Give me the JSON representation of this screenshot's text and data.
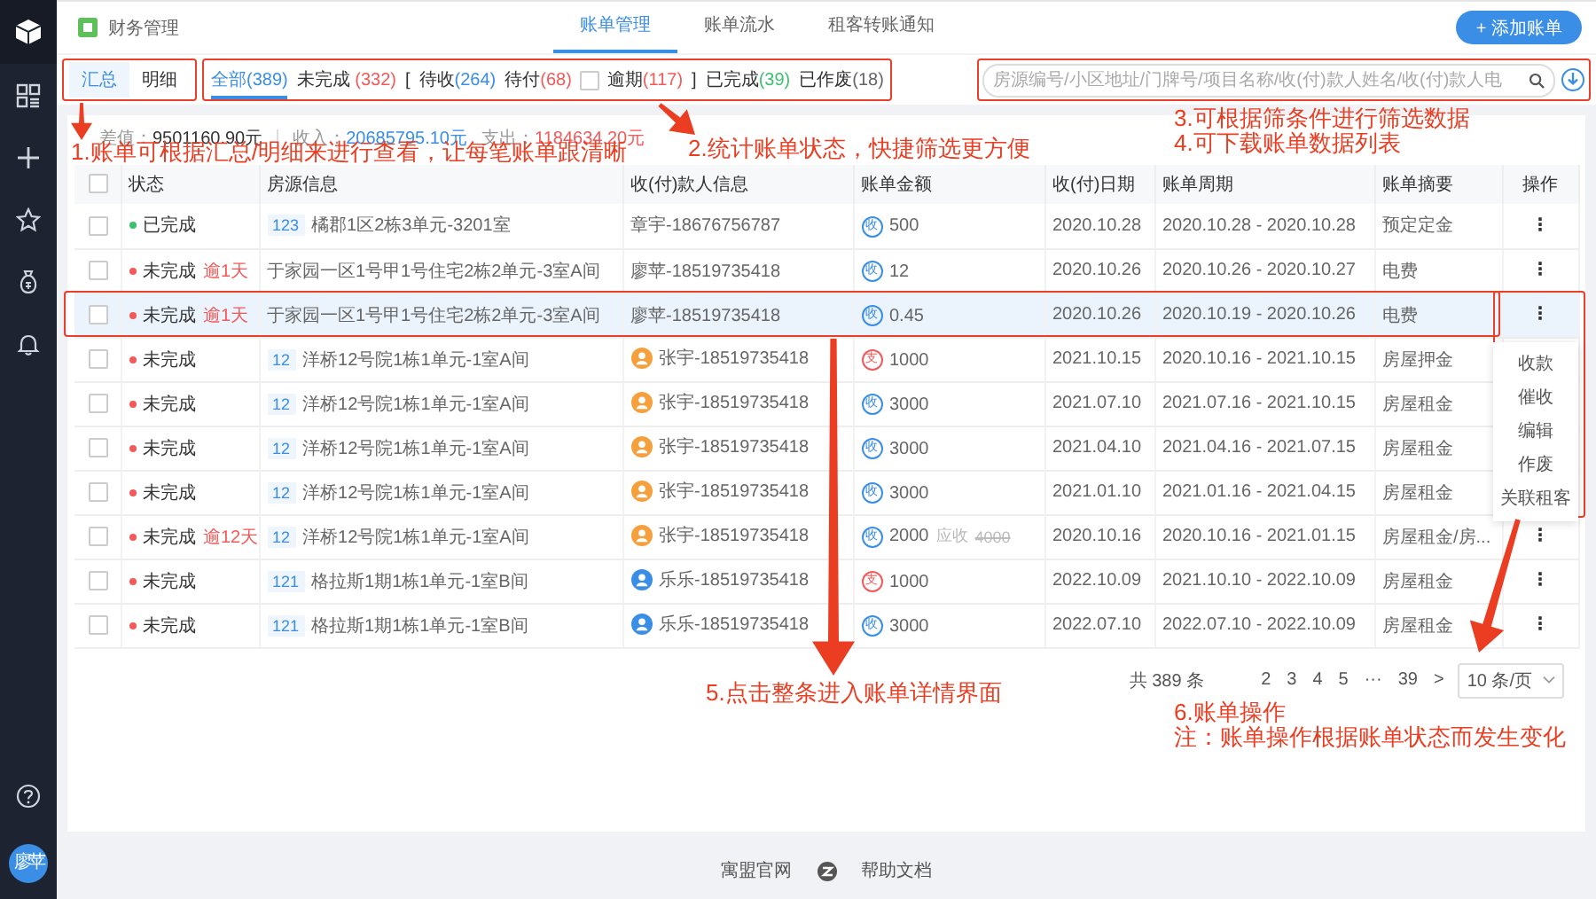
{
  "app": {
    "title": "财务管理",
    "nav_tabs": [
      {
        "label": "账单管理",
        "selected": true
      },
      {
        "label": "账单流水",
        "selected": false
      },
      {
        "label": "租客转账通知",
        "selected": false
      }
    ],
    "add_button": "+ 添加账单"
  },
  "sidebar": {
    "avatar": "廖苹"
  },
  "view_switch": [
    {
      "label": "汇总",
      "selected": true
    },
    {
      "label": "明细",
      "selected": false
    }
  ],
  "status_filters": [
    {
      "kind": "tab",
      "label": "全部",
      "count": "(389)",
      "color": "#3a8ee6",
      "selected": true
    },
    {
      "kind": "tab",
      "label": "未完成",
      "count": " (332)",
      "color": "#f25a5a",
      "selected": false
    },
    {
      "kind": "bracket",
      "label": "["
    },
    {
      "kind": "tab",
      "label": "待收",
      "count": "(264)",
      "color": "#3a8ee6",
      "selected": false
    },
    {
      "kind": "tab",
      "label": "待付",
      "count": "(68)",
      "color": "#f25a5a",
      "selected": false
    },
    {
      "kind": "check_tab",
      "label": "逾期",
      "count": "(117)",
      "color": "#f25a5a",
      "checked": false
    },
    {
      "kind": "bracket",
      "label": "]"
    },
    {
      "kind": "tab",
      "label": "已完成",
      "count": "(39)",
      "color": "#3fbf6f",
      "selected": false
    },
    {
      "kind": "tab",
      "label": "已作废",
      "count": "(18)",
      "color": "#666666",
      "selected": false
    }
  ],
  "search": {
    "placeholder": "房源编号/小区地址/门牌号/项目名称/收(付)款人姓名/收(付)款人电"
  },
  "summary": [
    {
      "kind": "neutral",
      "label": "差值：",
      "value": "9501160.90元"
    },
    {
      "kind": "income",
      "label": "收入：",
      "value": "20685795.10元"
    },
    {
      "kind": "expense",
      "label": "支出：",
      "value": "1184634.20元"
    }
  ],
  "table": {
    "header_checked": false,
    "columns": [
      "状态",
      "房源信息",
      "收(付)款人信息",
      "账单金额",
      "收(付)日期",
      "账单周期",
      "账单摘要",
      "操作"
    ],
    "rows": [
      {
        "checked": false,
        "highlighted": false,
        "status": {
          "kind": "done",
          "label": "已完成"
        },
        "room_tag": "123",
        "room": "橘郡1区2栋3单元-3201室",
        "payer": {
          "text": "章宇-18676756787"
        },
        "amount": {
          "kind": "in",
          "glyph": "收",
          "value": "500"
        },
        "date": "2020.10.28",
        "period": "2020.10.28 - 2020.10.28",
        "summary": "预定定金",
        "menu": "⋮"
      },
      {
        "checked": false,
        "highlighted": false,
        "status": {
          "kind": "pending",
          "label": "未完成",
          "overdue": "逾1天"
        },
        "room": "于家园一区1号甲1号住宅2栋2单元-3室A间",
        "payer": {
          "text": "廖苹-18519735418"
        },
        "amount": {
          "kind": "in",
          "glyph": "收",
          "value": "12"
        },
        "date": "2020.10.26",
        "period": "2020.10.26 - 2020.10.27",
        "summary": "电费",
        "menu": "⋮"
      },
      {
        "checked": false,
        "highlighted": true,
        "status": {
          "kind": "pending",
          "label": "未完成",
          "overdue": "逾1天"
        },
        "room": "于家园一区1号甲1号住宅2栋2单元-3室A间",
        "payer": {
          "text": "廖苹-18519735418"
        },
        "amount": {
          "kind": "in",
          "glyph": "收",
          "value": "0.45"
        },
        "date": "2020.10.26",
        "period": "2020.10.19 - 2020.10.26",
        "summary": "电费",
        "menu": "⋮"
      },
      {
        "checked": false,
        "highlighted": false,
        "status": {
          "kind": "pending",
          "label": "未完成"
        },
        "room_tag": "12",
        "room": "洋桥12号院1栋1单元-1室A间",
        "payer": {
          "text": "张宇-18519735418",
          "color": "#f5a03c"
        },
        "amount": {
          "kind": "out",
          "glyph": "支",
          "value": "1000"
        },
        "date": "2021.10.15",
        "period": "2020.10.16 - 2021.10.15",
        "summary": "房屋押金"
      },
      {
        "checked": false,
        "highlighted": false,
        "status": {
          "kind": "pending",
          "label": "未完成"
        },
        "room_tag": "12",
        "room": "洋桥12号院1栋1单元-1室A间",
        "payer": {
          "text": "张宇-18519735418",
          "color": "#f5a03c"
        },
        "amount": {
          "kind": "in",
          "glyph": "收",
          "value": "3000"
        },
        "date": "2021.07.10",
        "period": "2021.07.16 - 2021.10.15",
        "summary": "房屋租金"
      },
      {
        "checked": false,
        "highlighted": false,
        "status": {
          "kind": "pending",
          "label": "未完成"
        },
        "room_tag": "12",
        "room": "洋桥12号院1栋1单元-1室A间",
        "payer": {
          "text": "张宇-18519735418",
          "color": "#f5a03c"
        },
        "amount": {
          "kind": "in",
          "glyph": "收",
          "value": "3000"
        },
        "date": "2021.04.10",
        "period": "2021.04.16 - 2021.07.15",
        "summary": "房屋租金"
      },
      {
        "checked": false,
        "highlighted": false,
        "status": {
          "kind": "pending",
          "label": "未完成"
        },
        "room_tag": "12",
        "room": "洋桥12号院1栋1单元-1室A间",
        "payer": {
          "text": "张宇-18519735418",
          "color": "#f5a03c"
        },
        "amount": {
          "kind": "in",
          "glyph": "收",
          "value": "3000"
        },
        "date": "2021.01.10",
        "period": "2021.01.16 - 2021.04.15",
        "summary": "房屋租金"
      },
      {
        "checked": false,
        "highlighted": false,
        "status": {
          "kind": "pending",
          "label": "未完成",
          "overdue": "逾12天"
        },
        "room_tag": "12",
        "room": "洋桥12号院1栋1单元-1室A间",
        "payer": {
          "text": "张宇-18519735418",
          "color": "#f5a03c"
        },
        "amount": {
          "kind": "in",
          "glyph": "收",
          "value": "2000",
          "due_label": "应收",
          "due_value": "4000"
        },
        "date": "2020.10.16",
        "period": "2020.10.16 - 2021.01.15",
        "summary": "房屋租金/房...",
        "menu": "⋮"
      },
      {
        "checked": false,
        "highlighted": false,
        "status": {
          "kind": "pending",
          "label": "未完成"
        },
        "room_tag": "121",
        "room": "格拉斯1期1栋1单元-1室B间",
        "payer": {
          "text": "乐乐-18519735418",
          "color": "#3a8ee6"
        },
        "amount": {
          "kind": "out",
          "glyph": "支",
          "value": "1000"
        },
        "date": "2022.10.09",
        "period": "2021.10.10 - 2022.10.09",
        "summary": "房屋租金",
        "menu": "⋮"
      },
      {
        "checked": false,
        "highlighted": false,
        "status": {
          "kind": "pending",
          "label": "未完成"
        },
        "room_tag": "121",
        "room": "格拉斯1期1栋1单元-1室B间",
        "payer": {
          "text": "乐乐-18519735418",
          "color": "#3a8ee6"
        },
        "amount": {
          "kind": "in",
          "glyph": "收",
          "value": "3000"
        },
        "date": "2022.07.10",
        "period": "2022.07.10 - 2022.10.09",
        "summary": "房屋租金",
        "menu": "⋮"
      }
    ],
    "action_menu": [
      "收款",
      "催收",
      "编辑",
      "作废",
      "关联租客"
    ]
  },
  "pagination": {
    "total": "共 389 条",
    "pages": [
      {
        "label": "2",
        "selected": false
      },
      {
        "label": "3",
        "selected": false
      },
      {
        "label": "4",
        "selected": false
      },
      {
        "label": "5",
        "selected": false
      }
    ],
    "ellipsis": "···",
    "last": "39",
    "next": ">",
    "page_size": "10 条/页"
  },
  "footer": {
    "links": [
      "寓盟官网",
      "帮助文档"
    ]
  },
  "annotations": [
    {
      "lines": [
        "1.账单可根据汇总/明细来进行查看，让每笔账单跟清晰"
      ]
    },
    {
      "lines": [
        "2.统计账单状态，快捷筛选更方便"
      ]
    },
    {
      "lines": [
        "3.可根据筛条件进行筛选数据",
        "4.可下载账单数据列表"
      ]
    },
    {
      "lines": [
        "5.点击整条进入账单详情界面"
      ]
    },
    {
      "lines": [
        "6.账单操作",
        "注：账单操作根据账单状态而发生变化"
      ]
    }
  ]
}
